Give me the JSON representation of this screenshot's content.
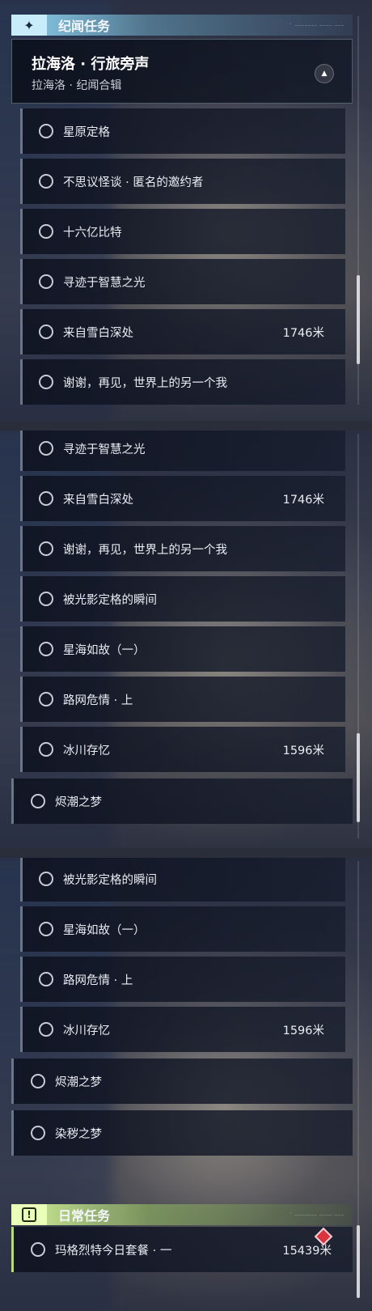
{
  "panel1": {
    "section": {
      "badge_icon": "sparkle-icon",
      "badge_glyph": "✦",
      "title": "纪闻任务",
      "tail": "ﾟ ─────── ──── ───"
    },
    "group": {
      "title": "拉海洛 · 行旅旁声",
      "subtitle": "拉海洛 · 纪闻合辑",
      "collapse_glyph": "▲"
    },
    "items": [
      {
        "label": "星原定格",
        "distance": ""
      },
      {
        "label": "不思议怪谈 · 匿名的邀约者",
        "distance": ""
      },
      {
        "label": "十六亿比特",
        "distance": ""
      },
      {
        "label": "寻迹于智慧之光",
        "distance": ""
      },
      {
        "label": "来自雪白深处",
        "distance": "1746米"
      },
      {
        "label": "谢谢，再见，世界上的另一个我",
        "distance": ""
      }
    ]
  },
  "panel2": {
    "items": [
      {
        "label": "寻迹于智慧之光",
        "distance": ""
      },
      {
        "label": "来自雪白深处",
        "distance": "1746米"
      },
      {
        "label": "谢谢，再见，世界上的另一个我",
        "distance": ""
      },
      {
        "label": "被光影定格的瞬间",
        "distance": ""
      },
      {
        "label": "星海如故（一）",
        "distance": ""
      },
      {
        "label": "路网危情 · 上",
        "distance": ""
      },
      {
        "label": "冰川存忆",
        "distance": "1596米"
      }
    ],
    "top_items": [
      {
        "label": "烬潮之梦",
        "distance": ""
      }
    ]
  },
  "panel3": {
    "items": [
      {
        "label": "被光影定格的瞬间",
        "distance": ""
      },
      {
        "label": "星海如故（一）",
        "distance": ""
      },
      {
        "label": "路网危情 · 上",
        "distance": ""
      },
      {
        "label": "冰川存忆",
        "distance": "1596米"
      }
    ],
    "top_items": [
      {
        "label": "烬潮之梦",
        "distance": ""
      },
      {
        "label": "染秽之梦",
        "distance": ""
      }
    ],
    "daily_section": {
      "badge_icon": "exclamation-icon",
      "badge_glyph": "!",
      "title": "日常任务",
      "tail": "ﾟ ─────── ──── ───"
    },
    "daily_items": [
      {
        "label": "玛格烈特今日套餐 · 一",
        "distance": "15439米",
        "marker": "red-diamond-icon"
      }
    ]
  },
  "colors": {
    "daily_accent": "#b7db78",
    "mission_accent": "#8fd3ef",
    "alert": "#d9343f"
  }
}
